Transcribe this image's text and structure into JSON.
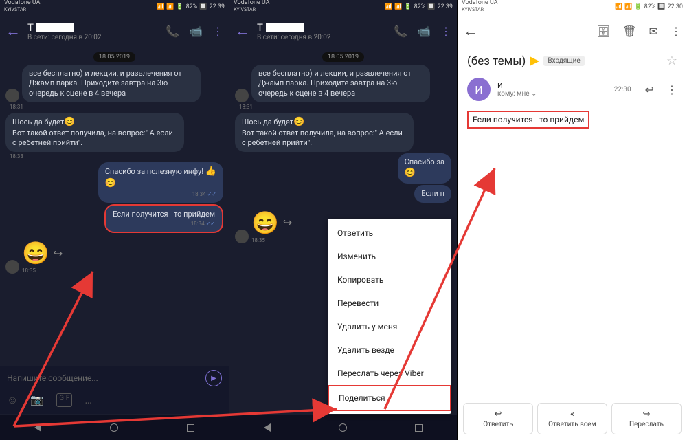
{
  "status": {
    "carrier": "Vodafone UA",
    "carrier2": "KYIVSTAR",
    "battery": "82%",
    "time": "22:39",
    "time3": "22:30"
  },
  "chat": {
    "name_prefix": "Т",
    "online": "В сети: сегодня в 20:02",
    "date": "18.05.2019",
    "m1": "все бесплатно) и лекции, и развлечения от Джамп парка. Приходите завтра на 3ю очередь к сцене в 4 вечера",
    "t1": "18:31",
    "m2a": "Шось да будет",
    "m2b": "Вот такой ответ получила, на вопрос:\" А если с ребетней прийти\".",
    "t2": "18:33",
    "m3": "Спасибо за полезную инфу!",
    "t3": "18:34",
    "m4": "Если получится - то прийдем",
    "t4": "18:34",
    "t5": "18:35",
    "m3_trunc": "Спасибо за",
    "m4_trunc": "Если п",
    "input_placeholder": "Напишите сообщение..."
  },
  "menu": {
    "items": [
      "Ответить",
      "Изменить",
      "Копировать",
      "Перевести",
      "Удалить у меня",
      "Удалить везде",
      "Переслать через Viber",
      "Поделиться"
    ]
  },
  "email": {
    "subject": "(без темы)",
    "folder": "Входящие",
    "avatar_letter": "И",
    "sender_prefix": "И",
    "to": "кому: мне",
    "time": "22:30",
    "body": "Если получится - то прийдем",
    "actions": [
      "Ответить",
      "Ответить всем",
      "Переслать"
    ]
  }
}
